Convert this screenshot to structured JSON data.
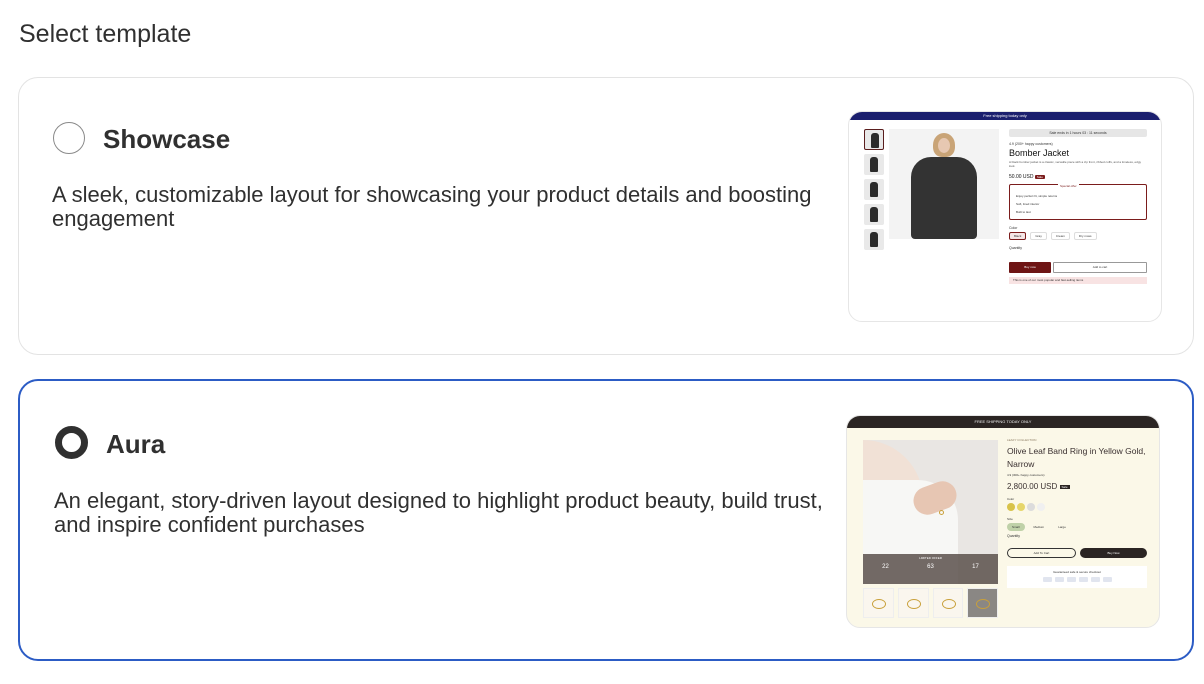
{
  "page": {
    "title": "Select template"
  },
  "templates": [
    {
      "name": "Showcase",
      "description": "A sleek, customizable layout for showcasing your product details and boosting engagement",
      "selected": false,
      "preview": {
        "banner": "Free shipping today only",
        "timer": "Sale ends in 1 hours 03 : 11 seconds",
        "rating": "4.9 (200+ happy customers)",
        "product_name": "Bomber Jacket",
        "product_desc": "A black bomber jacket is a classic, versatile piece with a zip front, ribbed cuffs, and a timeless, edgy look.",
        "price": "50.00 USD",
        "sale_badge": "Sale",
        "offer_label": "Special offer",
        "offer_lines": [
          "Enjoy perfect fit, simple returns",
          "Soft, lined interior",
          "Built to last"
        ],
        "color_label": "Color",
        "colors": [
          "Black",
          "Gray",
          "Cream",
          "Dry moss"
        ],
        "quantity_label": "Quantity",
        "buy_now": "Buy now",
        "add_to_cart": "Add to cart",
        "note": "This is one of our most popular and fast-selling items"
      }
    },
    {
      "name": "Aura",
      "description": "An elegant, story-driven layout designed to highlight product beauty, build trust, and inspire confident purchases",
      "selected": true,
      "preview": {
        "banner": "FREE SHIPPING TODAY ONLY",
        "collection": "LEAFY COLLECTION",
        "product_name": "Olive Leaf Band Ring in Yellow Gold, Narrow",
        "rating": "4.9 (300+ happy customers)",
        "price": "2,800.00 USD",
        "badge": "Sale",
        "color_label": "Color",
        "size_label": "Size",
        "sizes": [
          "Small",
          "Medium",
          "Large"
        ],
        "quantity_label": "Quantity",
        "countdown_caption": "LIMITED OFFER",
        "countdown": [
          "22",
          "63",
          "17"
        ],
        "add_to_cart": "Add To Cart",
        "buy_now": "Buy Now",
        "guarantee": "Guaranteed safe & secure checkout"
      }
    }
  ],
  "colors": {
    "selected_border": "#2c5cc5",
    "showcase_banner": "#1b1f6e",
    "showcase_accent": "#7b1c1c",
    "aura_bg": "#fbf8e8",
    "aura_dark": "#2b2523"
  }
}
